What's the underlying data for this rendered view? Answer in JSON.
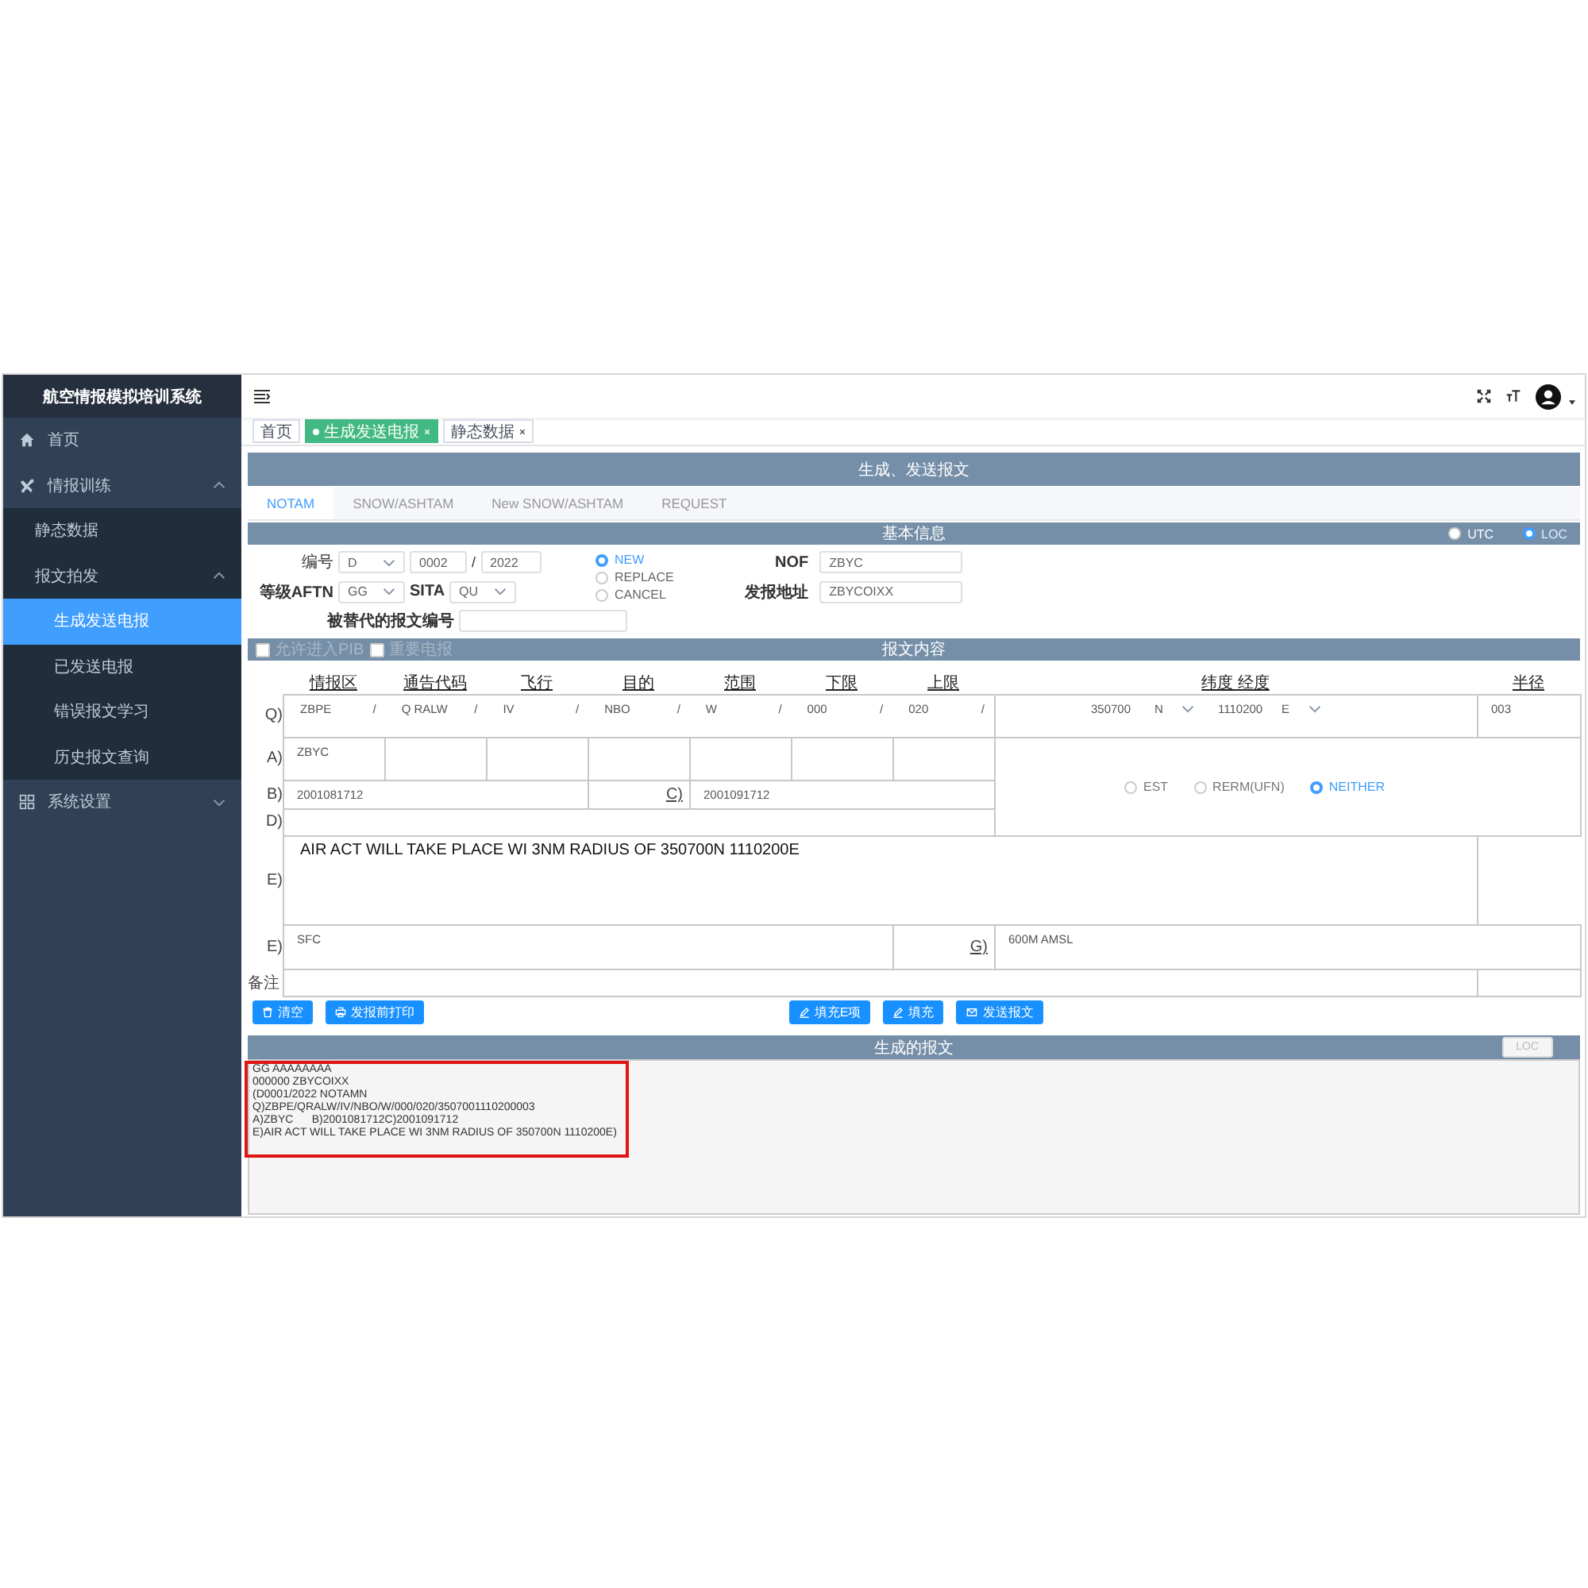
{
  "app_title": "航空情报模拟培训系统",
  "sidebar": {
    "items": [
      {
        "kind": "home",
        "label": "首页"
      },
      {
        "kind": "plane",
        "label": "情报训练",
        "expanded": true,
        "children": [
          {
            "label": "静态数据",
            "selected": false
          },
          {
            "label": "报文拍发",
            "expanded": true,
            "children": [
              {
                "label": "生成发送电报",
                "selected": true
              },
              {
                "label": "已发送电报",
                "selected": false
              },
              {
                "label": "错误报文学习",
                "selected": false
              },
              {
                "label": "历史报文查询",
                "selected": false
              }
            ]
          }
        ]
      },
      {
        "kind": "grid",
        "label": "系统设置",
        "expanded": false
      }
    ]
  },
  "tags": [
    {
      "label": "首页",
      "selected": false,
      "closable": false
    },
    {
      "label": "生成发送电报",
      "selected": true,
      "closable": true
    },
    {
      "label": "静态数据",
      "selected": false,
      "closable": true
    }
  ],
  "panel_title": "生成、发送报文",
  "tabs": [
    {
      "label": "NOTAM",
      "selected": true
    },
    {
      "label": "SNOW/ASHTAM",
      "selected": false
    },
    {
      "label": "New SNOW/ASHTAM",
      "selected": false
    },
    {
      "label": "REQUEST",
      "selected": false
    }
  ],
  "basic_info": {
    "title": "基本信息",
    "time_zone": [
      {
        "label": "UTC",
        "selected": false
      },
      {
        "label": "LOC",
        "selected": true
      }
    ]
  },
  "number": {
    "label": "编号",
    "series": "D",
    "serial": "0002",
    "separator": "/",
    "year": "2022"
  },
  "aftn": {
    "label": "等级AFTN",
    "value": "GG"
  },
  "sita": {
    "label": "SITA",
    "value": "QU"
  },
  "replaced": {
    "label": "被替代的报文编号"
  },
  "notam_type": [
    {
      "label": "NEW",
      "selected": true
    },
    {
      "label": "REPLACE",
      "selected": false
    },
    {
      "label": "CANCEL",
      "selected": false
    }
  ],
  "nof": {
    "label": "NOF",
    "value": "ZBYC"
  },
  "address": {
    "label": "发报地址",
    "value": "ZBYCOIXX"
  },
  "content": {
    "title": "报文内容",
    "options": [
      {
        "label": "允许进入PIB",
        "checked": false
      },
      {
        "label": "重要电报",
        "checked": false
      }
    ]
  },
  "q_headers": [
    "情报区",
    "通告代码",
    "飞行",
    "目的",
    "范围",
    "下限",
    "上限",
    "纬度 经度",
    "半径"
  ],
  "q_row": {
    "label": "Q)",
    "fields": [
      {
        "value": "ZBPE",
        "separator": "/"
      },
      {
        "value": "Q RALW",
        "separator": "/"
      },
      {
        "value": "IV",
        "separator": "/"
      },
      {
        "value": "NBO",
        "separator": "/"
      },
      {
        "value": "W",
        "separator": "/"
      },
      {
        "value": "000",
        "separator": "/"
      },
      {
        "value": "020",
        "separator": "/"
      }
    ],
    "lat": "350700",
    "ns": "N",
    "lon": "1110200",
    "ew": "E",
    "radius": "003"
  },
  "a_row": {
    "label": "A)",
    "cells": [
      "ZBYC"
    ]
  },
  "b": {
    "label": "B)",
    "value": "2001081712"
  },
  "c": {
    "label": "C)",
    "value": "2001091712"
  },
  "validity": [
    {
      "label": "EST",
      "selected": false
    },
    {
      "label": "RERM(UFN)",
      "selected": false
    },
    {
      "label": "NEITHER",
      "selected": true
    }
  ],
  "d": {
    "label": "D)"
  },
  "e": {
    "label": "E)",
    "value": "AIR ACT WILL TAKE PLACE WI 3NM RADIUS OF 350700N 1110200E"
  },
  "f": {
    "label": "E)",
    "value": "SFC"
  },
  "g": {
    "label": "G)",
    "value": "600M AMSL"
  },
  "remark": {
    "label": "备注"
  },
  "left_buttons": [
    {
      "kind": "trash",
      "label": "清空"
    },
    {
      "kind": "printer",
      "label": "发报前打印"
    }
  ],
  "center_buttons": [
    {
      "kind": "pencil",
      "label": "填充E项"
    },
    {
      "kind": "pencil",
      "label": "填充"
    },
    {
      "kind": "envelope",
      "label": "发送报文"
    }
  ],
  "generated": {
    "title": "生成的报文",
    "loc_button": "LOC",
    "highlighted": true,
    "lines": [
      "GG AAAAAAAA",
      "000000 ZBYCOIXX",
      "(D0001/2022 NOTAMN",
      "Q)ZBPE/QRALW/IV/NBO/W/000/020/3507001110200003",
      "A)ZBYC      B)2001081712C)2001091712",
      "E)AIR ACT WILL TAKE PLACE WI 3NM RADIUS OF 350700N 1110200E)"
    ]
  }
}
